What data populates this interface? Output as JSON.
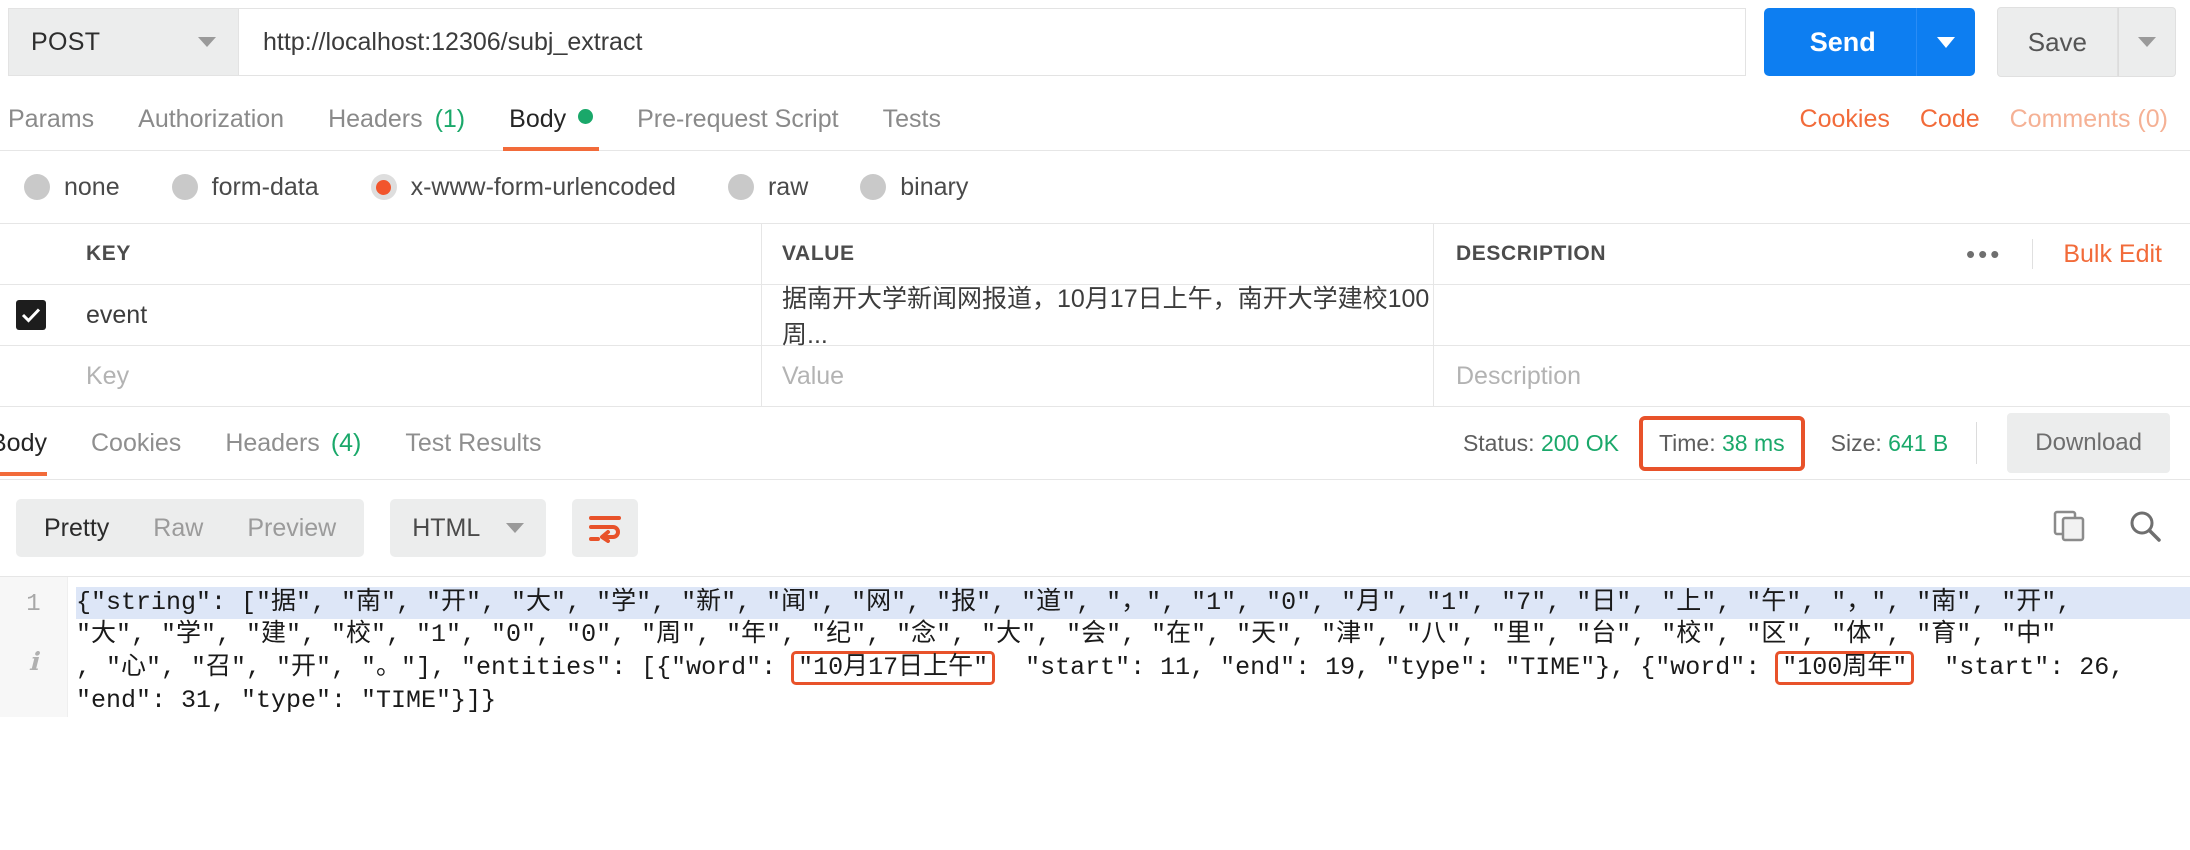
{
  "request": {
    "method": "POST",
    "url": "http://localhost:12306/subj_extract",
    "send_label": "Send",
    "save_label": "Save"
  },
  "request_tabs": [
    {
      "label": "Params",
      "count": "",
      "active": false
    },
    {
      "label": "Authorization",
      "count": "",
      "active": false
    },
    {
      "label": "Headers",
      "count": "(1)",
      "active": false
    },
    {
      "label": "Body",
      "count": "",
      "active": true
    },
    {
      "label": "Pre-request Script",
      "count": "",
      "active": false
    },
    {
      "label": "Tests",
      "count": "",
      "active": false
    }
  ],
  "tabs_right": {
    "cookies": "Cookies",
    "code": "Code",
    "comments": "Comments (0)"
  },
  "body_types": [
    {
      "label": "none",
      "checked": false
    },
    {
      "label": "form-data",
      "checked": false
    },
    {
      "label": "x-www-form-urlencoded",
      "checked": true
    },
    {
      "label": "raw",
      "checked": false
    },
    {
      "label": "binary",
      "checked": false
    }
  ],
  "kv_table": {
    "headers": {
      "key": "KEY",
      "value": "VALUE",
      "description": "DESCRIPTION"
    },
    "bulk_edit": "Bulk Edit",
    "ellipsis": "•••",
    "rows": [
      {
        "checked": true,
        "key": "event",
        "value": "据南开大学新闻网报道，10月17日上午，南开大学建校100周...",
        "description": ""
      }
    ],
    "placeholders": {
      "key": "Key",
      "value": "Value",
      "description": "Description"
    }
  },
  "response_tabs": [
    {
      "label": "Body",
      "count": "",
      "active": true
    },
    {
      "label": "Cookies",
      "count": "",
      "active": false
    },
    {
      "label": "Headers",
      "count": "(4)",
      "active": false
    },
    {
      "label": "Test Results",
      "count": "",
      "active": false
    }
  ],
  "response_meta": {
    "status_label": "Status:",
    "status_value": "200 OK",
    "time_label": "Time:",
    "time_value": "38 ms",
    "size_label": "Size:",
    "size_value": "641 B",
    "download_label": "Download",
    "time_highlight_color": "#e8522a"
  },
  "view_toolbar": {
    "segments": [
      {
        "label": "Pretty",
        "active": true
      },
      {
        "label": "Raw",
        "active": false
      },
      {
        "label": "Preview",
        "active": false
      }
    ],
    "language": "HTML",
    "copy_icon": "copy-icon",
    "search_icon": "search-icon",
    "wrap_icon": "word-wrap-icon"
  },
  "code": {
    "line_number": "1",
    "line1": "{\"string\": [\"据\", \"南\", \"开\", \"大\", \"学\", \"新\", \"闻\", \"网\", \"报\", \"道\", \"，\", \"1\", \"0\", \"月\", \"1\", \"7\", \"日\", \"上\", \"午\", \"，\", \"南\", \"开\",",
    "line2_a": "\"大\", \"学\", \"建\", \"校\", \"1\", \"0\", \"0\", \"周\", \"年\", \"纪\", \"念\", \"大\", \"会\", \"在\", \"天\", \"津\", \"八\", \"里\", \"台\", \"校\", \"区\", \"体\", \"育\", \"中\"",
    "line3_a": ", \"心\", \"召\", \"开\", \"。\"], \"entities\": [{\"word\": ",
    "entity1_word": "\"10月17日上午\"",
    "line3_b": "  \"start\": 11, \"end\": 19, \"type\": \"TIME\"}, {\"word\": ",
    "entity2_word": "\"100周年\"",
    "line3_c": "  \"start\": 26,",
    "line4": "\"end\": 31, \"type\": \"TIME\"}]}"
  }
}
